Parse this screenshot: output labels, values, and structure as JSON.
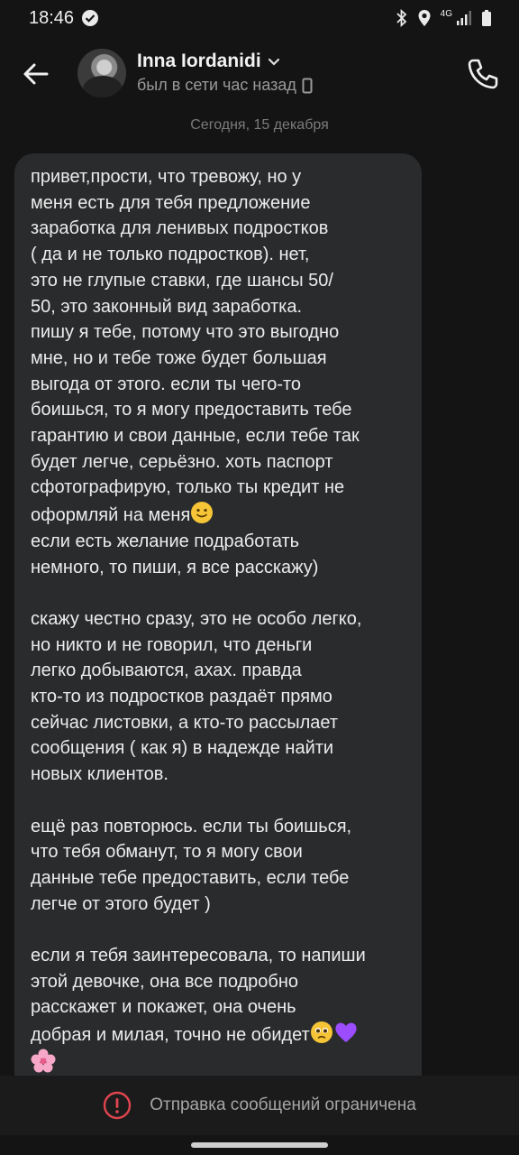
{
  "status_bar": {
    "time": "18:46",
    "network": "4G"
  },
  "header": {
    "contact_name": "Inna Iordanidi",
    "last_seen": "был в сети час назад"
  },
  "chat": {
    "date_separator": "Сегодня, 15 декабря",
    "message": {
      "p1": "привет,прости, что тревожу, но у\nменя есть для тебя предложение\nзаработка для ленивых подростков\n( да и не только подростков). нет,\nэто не глупые ставки, где шансы 50/\n50, это законный вид заработка.\nпишу я тебе, потому что это выгодно\nмне, но и тебе тоже будет большая\nвыгода от этого. если ты чего-то\nбоишься, то я могу предоставить тебе\nгарантию и свои данные, если тебе так\nбудет легче, серьёзно. хоть паспорт\nсфотографирую, только ты кредит не",
      "p1_last": "оформляй на меня",
      "p1_tail": "если есть желание подработать\nнемного, то пиши, я все расскажу)",
      "p2": "скажу честно сразу, это не особо легко,\nно никто и не говорил, что деньги\nлегко добываются, ахах. правда\nкто-то из подростков раздаёт прямо\nсейчас листовки, а кто-то рассылает\nсообщения ( как я) в надежде найти\nновых клиентов.",
      "p3": "ещё раз повторюсь. если ты боишься,\nчто тебя обманут, то я могу свои\nданные тебе предоставить, если тебе\nлегче от этого будет )",
      "p4": "если я тебя заинтересовала,  то напиши\nэтой девочке, она все подробно\nрасскажет и покажет, она очень",
      "p4_last": "добрая и милая, точно не обидет"
    }
  },
  "footer": {
    "restricted_label": "Отправка сообщений ограничена"
  },
  "colors": {
    "background": "#141414",
    "bubble": "#2a2b2d",
    "warning": "#e0454f",
    "emoji_heart": "#9b4dff"
  },
  "icons": [
    "check-circle-icon",
    "bluetooth-icon",
    "location-icon",
    "signal-icon",
    "battery-icon",
    "back-arrow-icon",
    "chevron-down-icon",
    "mobile-device-icon",
    "phone-icon",
    "warning-icon"
  ]
}
